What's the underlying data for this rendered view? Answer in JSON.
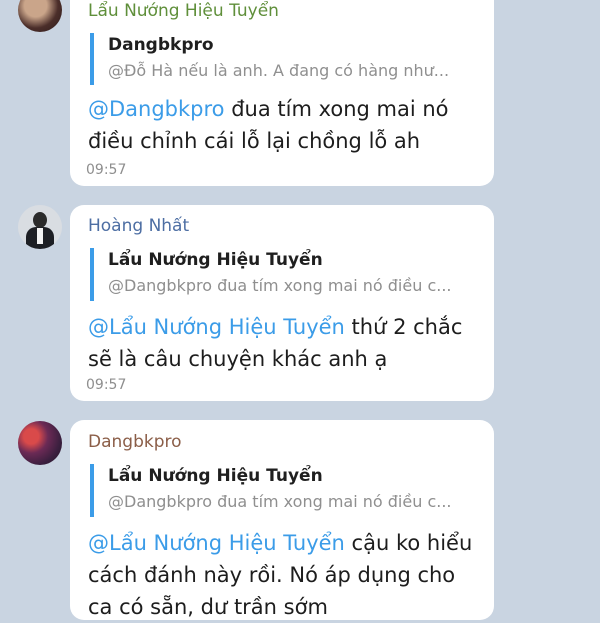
{
  "messages": [
    {
      "sender": "Lẩu Nướng Hiệu Tuyển",
      "quote_title": "Dangbkpro",
      "quote_text": "@Đỗ Hà nếu là anh. A đang có hàng như...",
      "mention": "@Dangbkpro",
      "text_line1_rest": " đua tím xong mai nó",
      "text_line2": "điều chỉnh cái lỗ lại chồng lỗ ah",
      "time": "09:57",
      "sender_color": "#5f8f3a"
    },
    {
      "sender": "Hoàng Nhất",
      "quote_title": "Lẩu Nướng Hiệu Tuyển",
      "quote_text": "@Dangbkpro đua tím xong mai nó điều c...",
      "mention": "@Lẩu Nướng Hiệu Tuyển",
      "text_line1_rest": " thứ 2 chắc",
      "text_line2": "sẽ là câu chuyện khác anh ạ",
      "time": "09:57",
      "sender_color": "#4d6ea3"
    },
    {
      "sender": "Dangbkpro",
      "quote_title": "Lẩu Nướng Hiệu Tuyển",
      "quote_text": "@Dangbkpro đua tím xong mai nó điều c...",
      "mention": "@Lẩu Nướng Hiệu Tuyển",
      "text_line1_rest": " cậu ko hiểu",
      "text_line2": "cách đánh này rồi. Nó áp dụng cho",
      "text_line3": "ca có sẵn, dư trần sớm",
      "sender_color": "#8b5e48"
    }
  ],
  "colors": {
    "background": "#c9d4e1",
    "accent": "#3b9ce8",
    "bubble": "#ffffff"
  }
}
